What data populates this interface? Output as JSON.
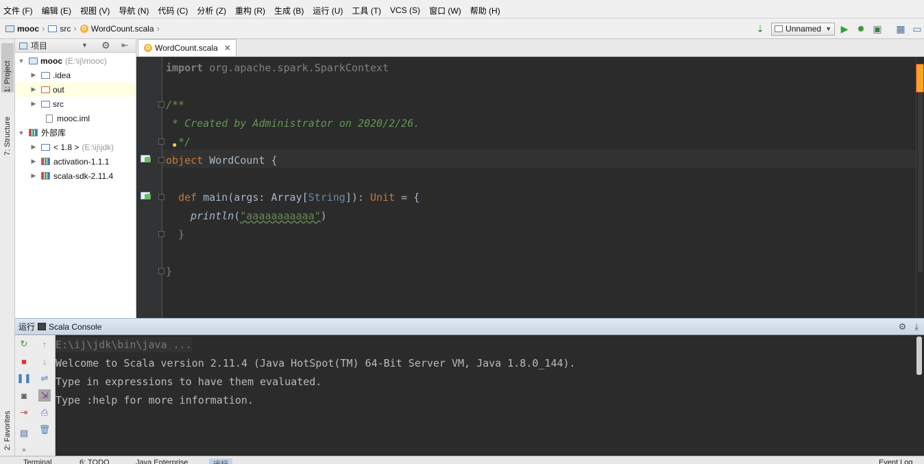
{
  "menu": [
    "文件 (F)",
    "编辑 (E)",
    "视图 (V)",
    "导航 (N)",
    "代码 (C)",
    "分析 (Z)",
    "重构 (R)",
    "生成 (B)",
    "运行 (U)",
    "工具 (T)",
    "VCS (S)",
    "窗口 (W)",
    "帮助 (H)"
  ],
  "breadcrumb": {
    "project": "mooc",
    "folder": "src",
    "file": "WordCount.scala"
  },
  "run_config": {
    "name": "Unnamed"
  },
  "left_tabs": {
    "project": "1: Project",
    "structure": "7: Structure",
    "favorites": "2: Favorites"
  },
  "project_panel": {
    "title": "项目",
    "tree": [
      {
        "label": "mooc",
        "extra": "(E:\\ij\\mooc)"
      },
      {
        "label": ".idea"
      },
      {
        "label": "out"
      },
      {
        "label": "src"
      },
      {
        "label": "mooc.iml"
      },
      {
        "label": "外部库"
      },
      {
        "label": "< 1.8 >",
        "extra": "(E:\\ij\\jdk)"
      },
      {
        "label": "activation-1.1.1"
      },
      {
        "label": "scala-sdk-2.11.4"
      }
    ]
  },
  "editor": {
    "tab_label": "WordCount.scala",
    "code": {
      "import_kw": "import",
      "import_path": " org.apache.spark.SparkContext",
      "doc_open": "/**",
      "doc_body": " * Created by Administrator on 2020/2/26.",
      "doc_close": "*/",
      "obj_kw": "object",
      "obj_name": " WordCount {",
      "def_kw": "def",
      "main_sig_1": " main(args: Array[",
      "main_type": "String",
      "main_sig_2": "]): ",
      "unit_kw": "Unit",
      "main_sig_3": " = {",
      "println": "println",
      "paren_open": "(",
      "string": "\"aaaaaaaaaaa\"",
      "paren_close": ")",
      "brace1": "}",
      "brace2": "}"
    }
  },
  "run_panel": {
    "label": "运行",
    "tab": "Scala Console",
    "lines": [
      "E:\\ij\\jdk\\bin\\java ...",
      "Welcome to Scala version 2.11.4 (Java HotSpot(TM) 64-Bit Server VM, Java 1.8.0_144).",
      "Type in expressions to have them evaluated.",
      "Type :help for more information."
    ]
  },
  "statusbar": {
    "terminal": "Terminal",
    "todo": "6: TODO",
    "java_ee": "Java Enterprise",
    "run": "运行",
    "event_log": "Event Log"
  }
}
